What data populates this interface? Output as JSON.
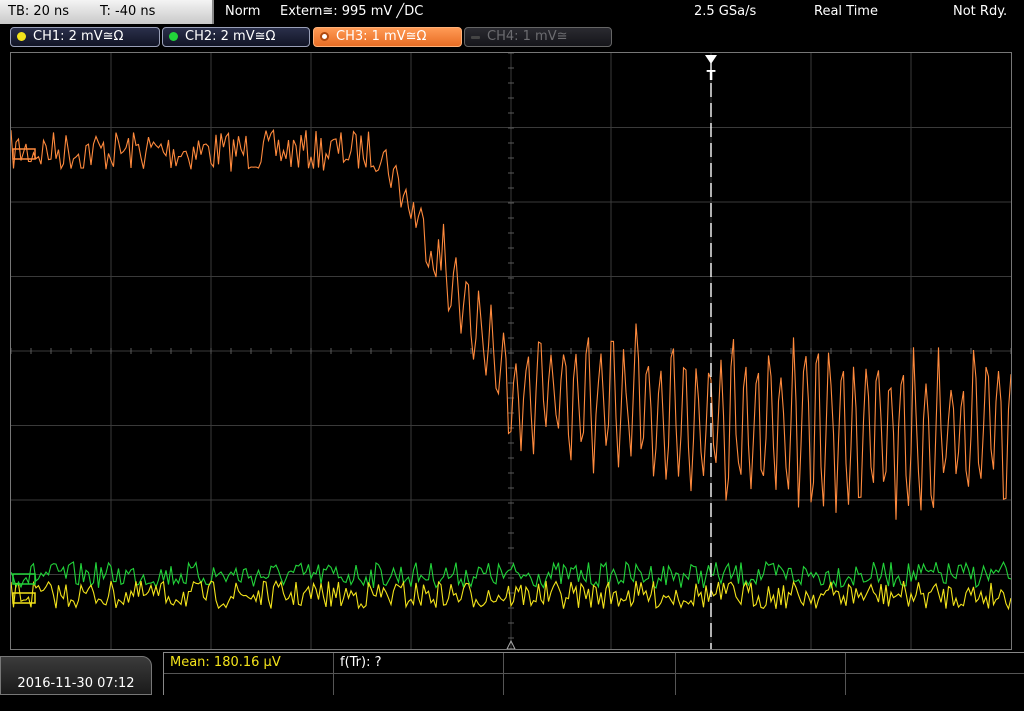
{
  "header": {
    "timebase": "TB: 20 ns",
    "trigger_time": "T: -40 ns",
    "trigger_mode": "Norm",
    "trigger_source": "Extern≅: 995 mV ╱DC",
    "sample_rate": "2.5 GSa/s",
    "acq_mode": "Real Time",
    "status": "Not Rdy."
  },
  "channels": [
    {
      "label": "CH1: 2 mV≅Ω",
      "color": "#f3e31b",
      "state": "on"
    },
    {
      "label": "CH2: 2 mV≅Ω",
      "color": "#22d43a",
      "state": "on"
    },
    {
      "label": "CH3: 1 mV≅Ω",
      "color": "#ff8a3d",
      "state": "active"
    },
    {
      "label": "CH4: 1 mV≅",
      "color": "#6a6a6a",
      "state": "off"
    }
  ],
  "measurements": {
    "mean": "Mean: 180.16 µV",
    "f_tr": "f(Tr): ?"
  },
  "footer": {
    "datetime": "2016-11-30 07:12"
  },
  "colors": {
    "ch1": "#f3e31b",
    "ch2": "#22d43a",
    "ch3": "#ff8a3d",
    "grid": "#3a3a3a",
    "meas_label": "#f3e31b"
  },
  "icons": {
    "trigger_marker": "trigger-t-icon",
    "channel_ground_markers": "channel-offset-icon"
  }
}
